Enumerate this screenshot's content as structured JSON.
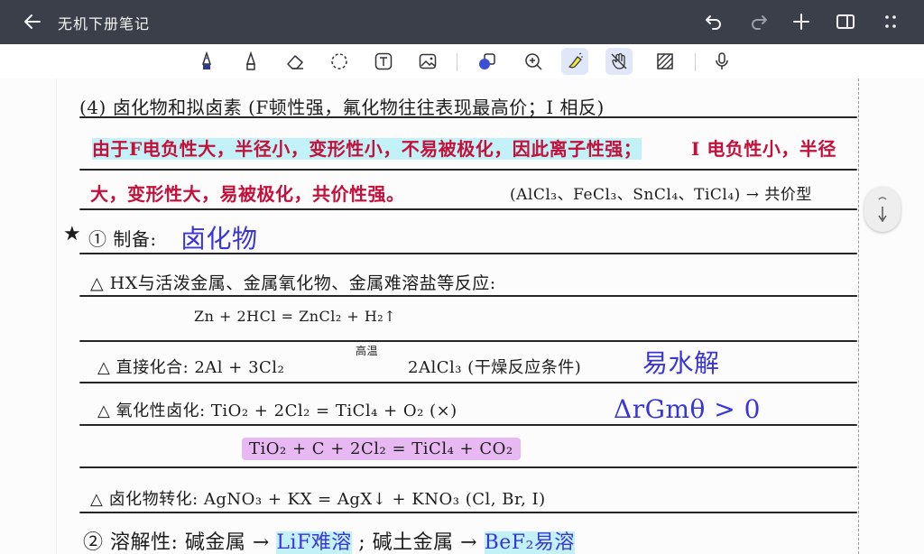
{
  "app": {
    "title": "无机下册笔记"
  },
  "topbar": {
    "icons": [
      "back-arrow-icon",
      "undo-icon",
      "redo-icon",
      "add-icon",
      "sidebar-icon",
      "more-icon"
    ]
  },
  "toolbar": {
    "tools": [
      "pen",
      "pencil",
      "eraser",
      "lasso",
      "text",
      "image",
      "shapes",
      "zoom",
      "highlighter",
      "hand-draw",
      "pattern",
      "microphone"
    ],
    "active": [
      "highlighter",
      "hand-draw"
    ]
  },
  "colors": {
    "topbar": "#3b3f49",
    "accent_active": "#dfe7f8",
    "ink_black": "#1c1c1c",
    "ink_red": "#c4103a",
    "ink_blue": "#3a35d8",
    "highlight_cyan": "#c2f2f7",
    "highlight_purple": "#e8b8f3"
  },
  "notes": {
    "line1": "(4) 卤化物和拟卤素 (F顿性强，氟化物往往表现最高价；I 相反)",
    "line2_hl": "由于F电负性大，半径小，变形性小，不易被极化，因此离子性强；",
    "line2_tail": "I 电负性小，半径",
    "line3": "大，变形性大，易被极化，共价性强。",
    "line3_tail": "(AlCl₃、FeCl₃、SnCl₄、TiCl₄) → 共价型",
    "line4_star": "★",
    "line4": "① 制备:",
    "line4_blue": "卤化物",
    "line5": "△ HX与活泼金属、金属氧化物、金属难溶盐等反应:",
    "line6": "Zn + 2HCl = ZnCl₂ + H₂↑",
    "line7": "△ 直接化合:   2Al + 3Cl₂",
    "line7_over": "高温",
    "line7b": "2AlCl₃  (干燥反应条件)",
    "line7_blue": "易水解",
    "line8": "△ 氧化性卤化:   TiO₂ + 2Cl₂ = TiCl₄ + O₂  (×)",
    "line8_blue": "ΔrGmθ > 0",
    "line9": "TiO₂ + C + 2Cl₂ = TiCl₄ + CO₂",
    "line10": "△ 卤化物转化:   AgNO₃ + KX = AgX↓ + KNO₃   (Cl, Br, I)",
    "line11": "② 溶解性:  碱金属 →",
    "line11_cyan": "LiF难溶",
    "line11b": "; 碱土金属 →",
    "line11_cyan2": "BeF₂易溶"
  }
}
